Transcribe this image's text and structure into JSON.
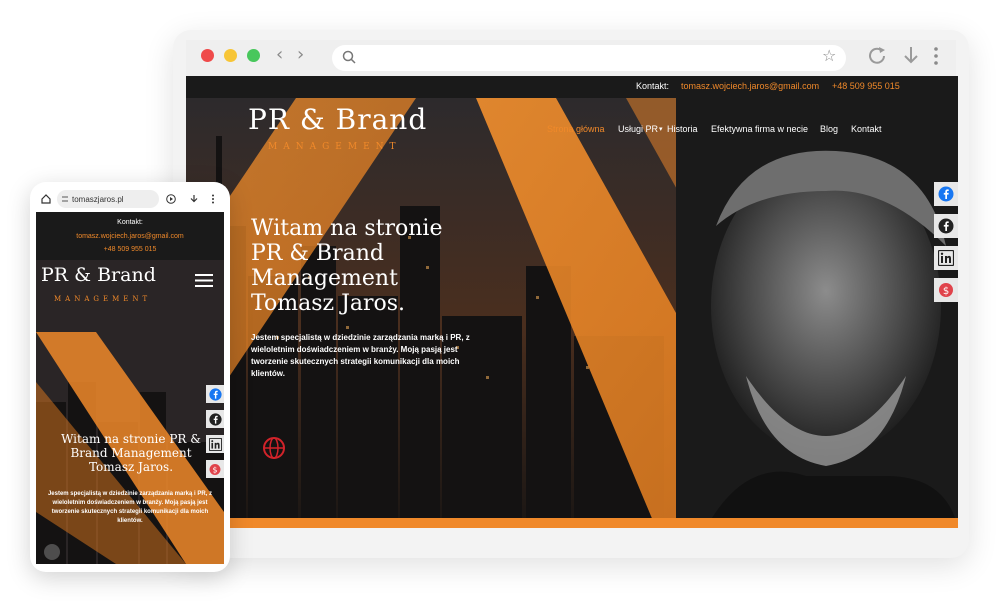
{
  "browser": {
    "nav_back": "‹",
    "nav_forward": "›",
    "star": "☆",
    "icons": [
      "search-icon",
      "star-icon",
      "reload-icon",
      "download-icon",
      "more-icon"
    ]
  },
  "site": {
    "contact_label": "Kontakt:",
    "email": "tomasz.wojciech.jaros@gmail.com",
    "phone": "+48 509 955 015",
    "logo_main": "PR & Brand",
    "logo_sub": "MANAGEMENT",
    "menu": {
      "home": "Strona główna",
      "services": "Usługi PR",
      "history": "Historia",
      "online": "Efektywna firma w necie",
      "blog": "Blog",
      "contact": "Kontakt"
    },
    "hero_title": "Witam na stronie PR & Brand Management Tomasz Jaros.",
    "hero_text": "Jestem specjalistą w dziedzinie zarządzania marką i PR, z wieloletnim doświadczeniem w branży. Moją pasją jest tworzenie skutecznych strategii komunikacji dla moich klientów.",
    "social": [
      "facebook-icon",
      "facebook-icon",
      "linkedin-icon",
      "money-icon"
    ]
  },
  "mobile": {
    "url": "tomaszjaros.pl",
    "contact_label": "Kontakt:",
    "email": "tomasz.wojciech.jaros@gmail.com",
    "phone": "+48 509 955 015",
    "logo_main": "PR & Brand",
    "logo_sub": "MANAGEMENT",
    "hero_title": "Witam na stronie PR & Brand Management Tomasz Jaros.",
    "hero_text": "Jestem specjalistą w dziedzinie zarządzania marką i PR, z wieloletnim doświadczeniem w branży. Moją pasją jest tworzenie skutecznych strategii komunikacji dla moich klientów."
  },
  "colors": {
    "accent": "#f0892a",
    "dark": "#1d1b1c",
    "text": "#ffffff"
  }
}
